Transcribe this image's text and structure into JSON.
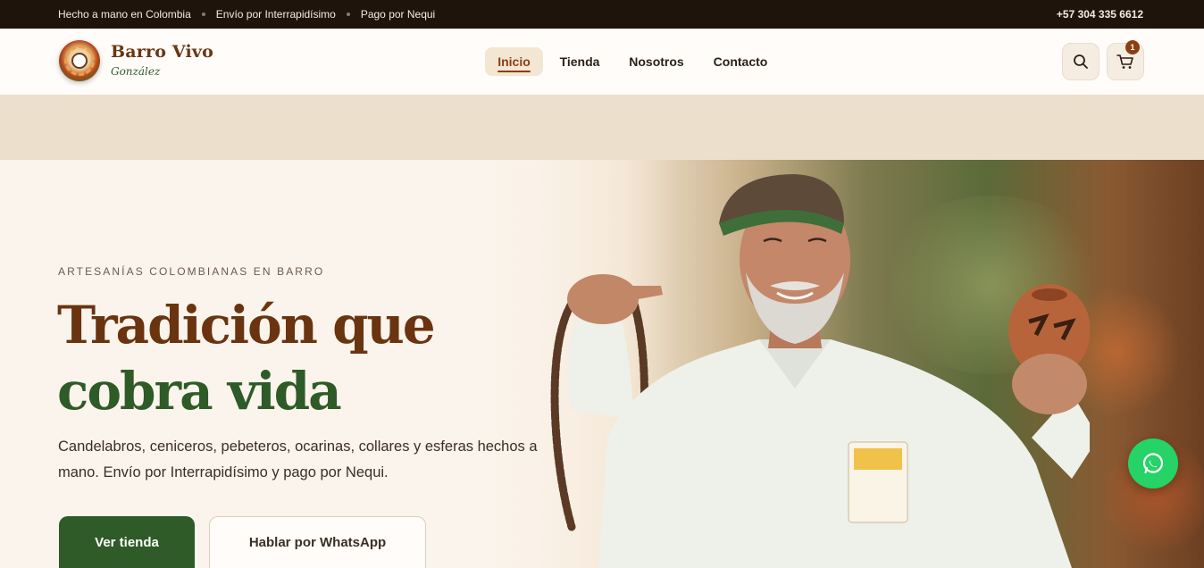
{
  "topbar": {
    "items": [
      "Hecho a mano en Colombia",
      "Envío por Interrapidísimo",
      "Pago por Nequi"
    ],
    "phone": "+57 304 335 6612"
  },
  "brand": {
    "name": "Barro Vivo",
    "subtitle": "González",
    "logo_icon": "pottery-logo-icon"
  },
  "nav": {
    "items": [
      "Inicio",
      "Tienda",
      "Nosotros",
      "Contacto"
    ],
    "active": "Inicio"
  },
  "header_actions": {
    "search_icon": "search-icon",
    "cart_icon": "cart-icon",
    "cart_count": "1"
  },
  "hero": {
    "eyebrow": "ARTESANÍAS COLOMBIANAS EN BARRO",
    "title_line1": "Tradición que",
    "title_line2": "cobra vida",
    "description": "Candelabros, ceniceros, pebeteros, ocarinas, collares y esferas hechos a mano. Envío por Interrapidísimo y pago por Nequi.",
    "primary_button": "Ver tienda",
    "secondary_button": "Hablar por WhatsApp"
  },
  "floating": {
    "whatsapp_icon": "whatsapp-icon"
  },
  "colors": {
    "brand_brown": "#6a3410",
    "brand_green": "#2e5b27",
    "topbar_bg": "#1f140c",
    "whatsapp_green": "#25d366"
  }
}
